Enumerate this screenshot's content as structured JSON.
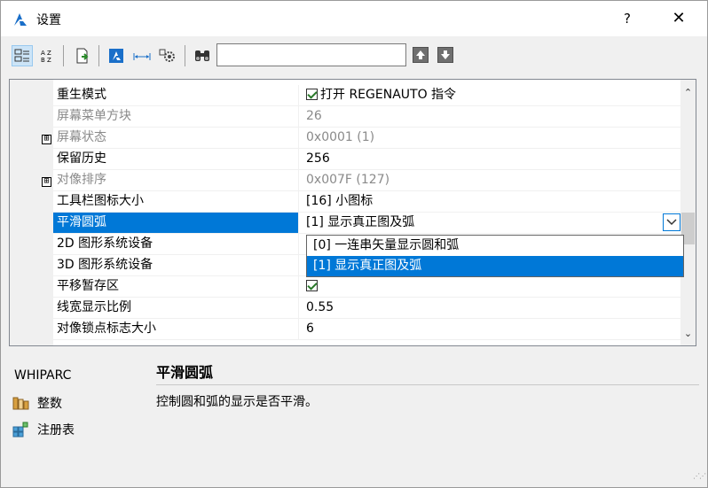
{
  "window": {
    "title": "设置",
    "help_label": "?",
    "close_label": "✕"
  },
  "toolbar": {
    "search_value": "",
    "buttons": [
      "categorized-view-icon",
      "alphabetical-view-icon",
      "export-icon",
      "system-variable-icon",
      "dimension-icon",
      "gear-settings-icon",
      "binoculars-icon",
      "arrow-up-icon",
      "arrow-down-icon"
    ]
  },
  "grid": {
    "rows": [
      {
        "name": "重生模式",
        "value": "打开 REGENAUTO 指令",
        "checkbox": true
      },
      {
        "name": "屏幕菜单方块",
        "value": "26",
        "disabled": true
      },
      {
        "name": "屏幕状态",
        "value": "0x0001 (1)",
        "disabled": true,
        "expander": "⊞"
      },
      {
        "name": "保留历史",
        "value": "256"
      },
      {
        "name": "对像排序",
        "value": "0x007F (127)",
        "disabled": true,
        "expander": "⊞"
      },
      {
        "name": "工具栏图标大小",
        "value": "[16] 小图标"
      },
      {
        "name": "平滑圆弧",
        "value": "[1] 显示真正图及弧",
        "selected": true
      },
      {
        "name": "2D 图形系统设备",
        "value": ""
      },
      {
        "name": "3D 图形系统设备",
        "value": ""
      },
      {
        "name": "平移暂存区",
        "value": "",
        "checkbox": true
      },
      {
        "name": "线宽显示比例",
        "value": "0.55"
      },
      {
        "name": "对像锁点标志大小",
        "value": "6"
      }
    ],
    "dropdown_options": [
      {
        "label": "[0] 一连串矢量显示圆和弧"
      },
      {
        "label": "[1] 显示真正图及弧",
        "selected": true
      }
    ]
  },
  "description": {
    "variable": "WHIPARC",
    "title": "平滑圆弧",
    "text": "控制圆和弧的显示是否平滑。",
    "type_label": "整数",
    "storage_label": "注册表"
  },
  "colors": {
    "selection": "#0078d7",
    "disabled_text": "#8a8a8a"
  }
}
